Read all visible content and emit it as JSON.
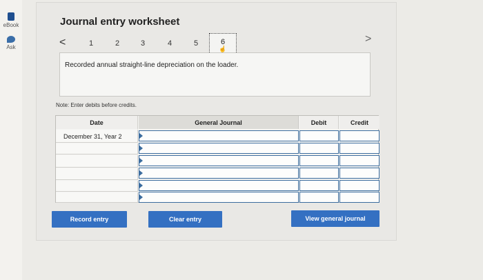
{
  "sidebar": {
    "items": [
      {
        "label": "eBook",
        "icon": "book-icon"
      },
      {
        "label": "Ask",
        "icon": "chat-bubble-icon"
      }
    ]
  },
  "worksheet": {
    "title": "Journal entry worksheet",
    "nav": {
      "prev": "<",
      "next": ">",
      "steps": [
        "1",
        "2",
        "3",
        "4",
        "5",
        "6"
      ],
      "active_step": "6"
    },
    "description": "Recorded annual straight-line depreciation on the loader.",
    "note": "Note: Enter debits before credits.",
    "table": {
      "headers": {
        "date": "Date",
        "general_journal": "General Journal",
        "debit": "Debit",
        "credit": "Credit"
      },
      "rows": [
        {
          "date": "December 31, Year 2",
          "account": "",
          "debit": "",
          "credit": ""
        },
        {
          "date": "",
          "account": "",
          "debit": "",
          "credit": ""
        },
        {
          "date": "",
          "account": "",
          "debit": "",
          "credit": ""
        },
        {
          "date": "",
          "account": "",
          "debit": "",
          "credit": ""
        },
        {
          "date": "",
          "account": "",
          "debit": "",
          "credit": ""
        },
        {
          "date": "",
          "account": "",
          "debit": "",
          "credit": ""
        }
      ]
    },
    "buttons": {
      "record": "Record entry",
      "clear": "Clear entry",
      "view": "View general journal"
    }
  },
  "colors": {
    "button": "#3470c2",
    "input_border": "#3b6c9e"
  }
}
